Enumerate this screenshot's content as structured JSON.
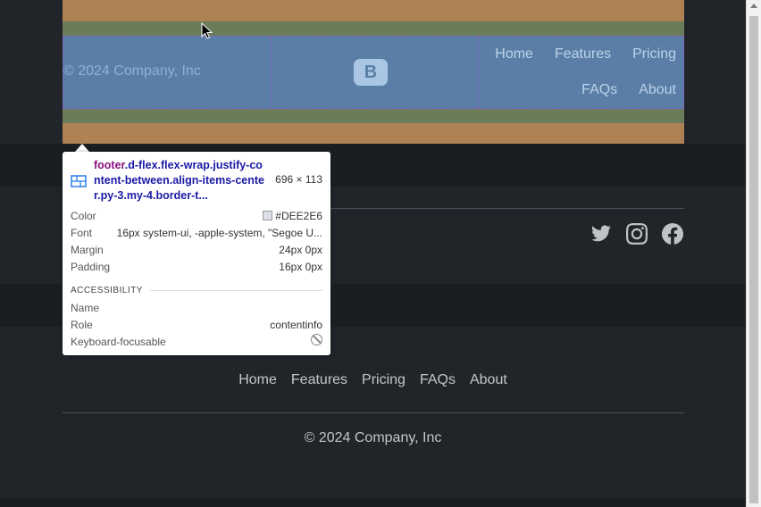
{
  "highlighted_footer": {
    "copyright": "© 2024 Company, Inc",
    "logo_letter": "B",
    "nav": [
      "Home",
      "Features",
      "Pricing",
      "FAQs",
      "About"
    ]
  },
  "social_icons": [
    "twitter-icon",
    "instagram-icon",
    "facebook-icon"
  ],
  "footer_nav": [
    "Home",
    "Features",
    "Pricing",
    "FAQs",
    "About"
  ],
  "footer_copyright": "© 2024 Company, Inc",
  "tooltip": {
    "selector_tag": "footer",
    "selector_classes": ".d-flex.flex-wrap.justify-content-between.align-items-center.py-3.my-4.border-t...",
    "dimensions": "696 × 113",
    "color_label": "Color",
    "color_value": "#DEE2E6",
    "font_label": "Font",
    "font_value": "16px system-ui, -apple-system, \"Segoe U...",
    "margin_label": "Margin",
    "margin_value": "24px 0px",
    "padding_label": "Padding",
    "padding_value": "16px 0px",
    "section_title": "ACCESSIBILITY",
    "name_label": "Name",
    "name_value": "",
    "role_label": "Role",
    "role_value": "contentinfo",
    "focusable_label": "Keyboard-focusable"
  }
}
